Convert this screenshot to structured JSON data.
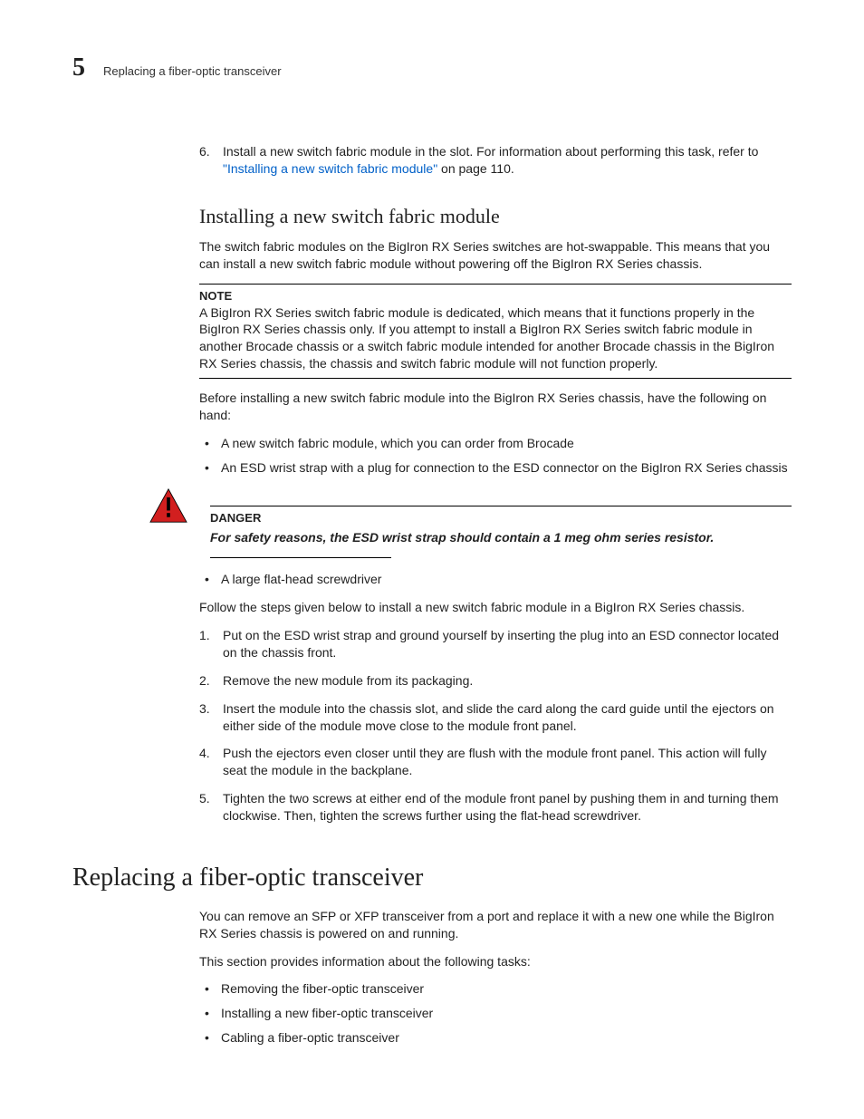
{
  "header": {
    "chapter_number": "5",
    "running_title": "Replacing a fiber-optic transceiver"
  },
  "step6": {
    "number": "6.",
    "text_a": "Install a new switch fabric module in the slot. For information about performing this task, refer to ",
    "link": "\"Installing a new switch fabric module\"",
    "text_b": " on page 110."
  },
  "section_install": {
    "heading": "Installing a new switch fabric module",
    "intro": "The switch fabric modules on the BigIron RX Series switches are hot-swappable. This means that you can install a new switch fabric module without powering off the BigIron RX Series chassis.",
    "note_kw": "NOTE",
    "note_text": "A BigIron RX Series switch fabric module is dedicated, which means that it functions properly in the BigIron RX Series chassis only. If you attempt to install a BigIron RX Series switch fabric module in another Brocade chassis or a switch fabric module intended for another Brocade chassis in the BigIron RX Series chassis, the chassis and switch fabric module will not function properly.",
    "before_text": "Before installing a new switch fabric module into the BigIron RX Series chassis, have the following on hand:",
    "pre_bullets": [
      "A new switch fabric module, which you can order from Brocade",
      "An ESD wrist strap with a plug for connection to the ESD connector on the BigIron RX Series chassis"
    ],
    "danger_kw": "DANGER",
    "danger_text": "For safety reasons, the ESD wrist strap should contain a 1 meg ohm series resistor.",
    "post_bullets": [
      "A large flat-head screwdriver"
    ],
    "follow_text": "Follow the steps given below to install a new switch fabric module in a BigIron RX Series chassis.",
    "steps": [
      "Put on the ESD wrist strap and ground yourself by inserting the plug into an ESD connector located on the chassis front.",
      "Remove the new module from its packaging.",
      "Insert the module into the chassis slot, and slide the card along the card guide until the ejectors on either side of the module move close to the module front panel.",
      "Push the ejectors even closer until they are flush with the module front panel. This action will fully seat the module in the backplane.",
      "Tighten the two screws at either end of the module front panel by pushing them in and turning them clockwise. Then, tighten the screws further using the flat-head screwdriver."
    ]
  },
  "section_replace": {
    "heading": "Replacing a fiber-optic transceiver",
    "intro": "You can remove an SFP or XFP transceiver from a port and replace it with a new one while the BigIron RX Series chassis is powered on and running.",
    "tasks_intro": "This section provides information about the following tasks:",
    "tasks": [
      "Removing the fiber-optic transceiver",
      "Installing a new fiber-optic transceiver",
      "Cabling a fiber-optic transceiver"
    ]
  }
}
